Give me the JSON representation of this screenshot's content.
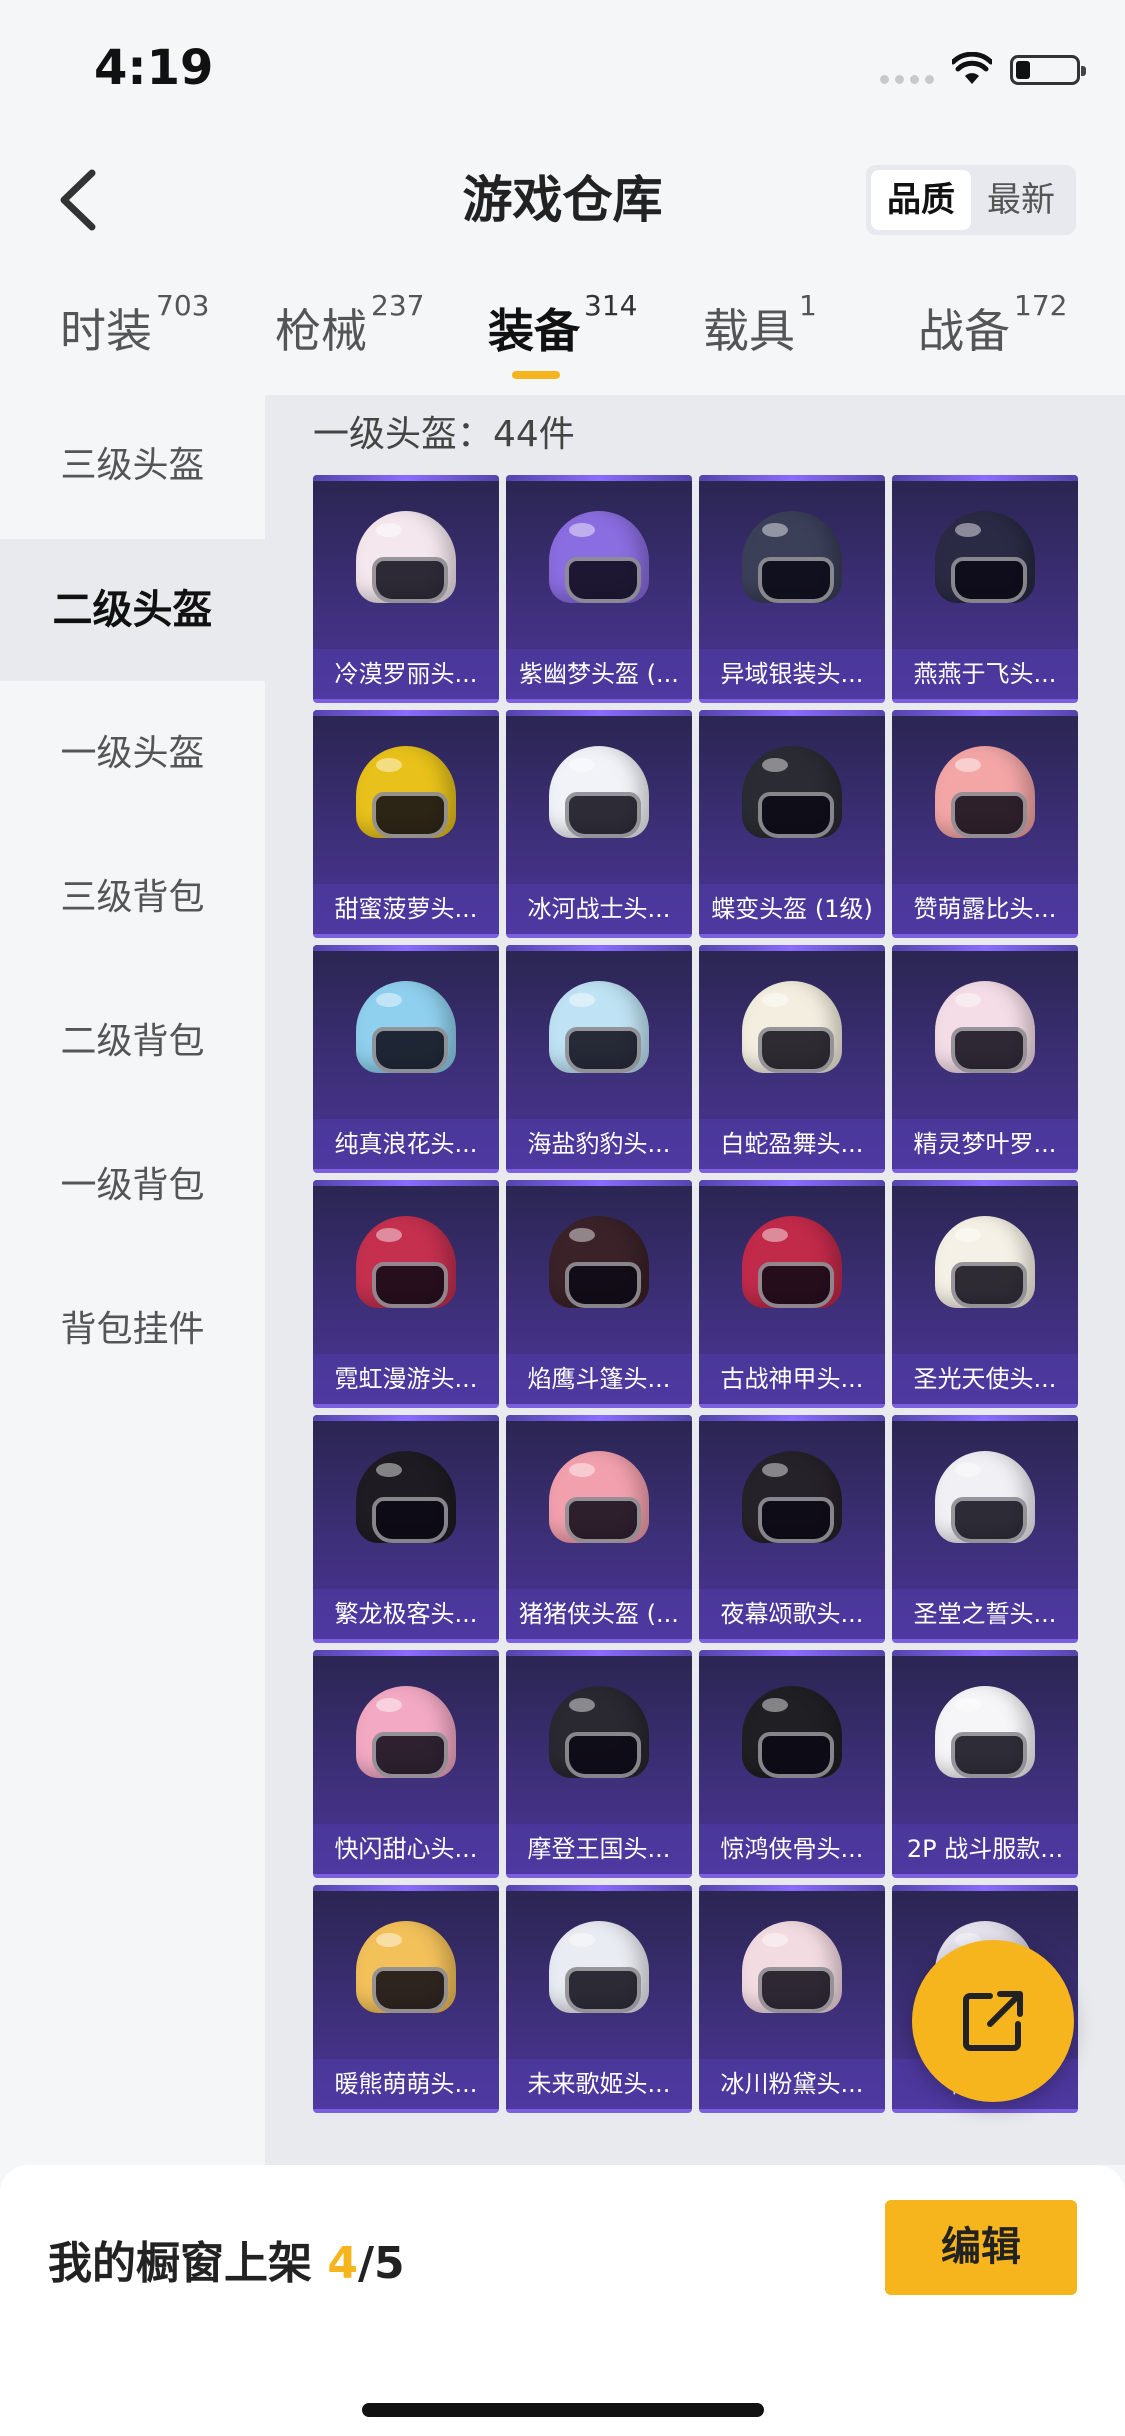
{
  "status_bar": {
    "time": "4:19"
  },
  "header": {
    "title": "游戏仓库",
    "sort_options": [
      "品质",
      "最新"
    ],
    "active_sort": "品质"
  },
  "tabs": [
    {
      "label": "时装",
      "count": "703"
    },
    {
      "label": "枪械",
      "count": "237"
    },
    {
      "label": "装备",
      "count": "314"
    },
    {
      "label": "载具",
      "count": "1"
    },
    {
      "label": "战备",
      "count": "172"
    }
  ],
  "active_tab": "装备",
  "sidebar": {
    "items": [
      "三级头盔",
      "二级头盔",
      "一级头盔",
      "三级背包",
      "二级背包",
      "一级背包",
      "背包挂件"
    ],
    "active": "二级头盔"
  },
  "section_title": "一级头盔：44件",
  "items": [
    {
      "label": "冷漠罗丽头...",
      "color": "#f4e8ee"
    },
    {
      "label": "紫幽梦头盔 (...",
      "color": "#8a6de0"
    },
    {
      "label": "异域银装头...",
      "color": "#3b3f58"
    },
    {
      "label": "燕燕于飞头...",
      "color": "#2a2a44"
    },
    {
      "label": "甜蜜菠萝头...",
      "color": "#e8c21a"
    },
    {
      "label": "冰河战士头...",
      "color": "#f1f3f8"
    },
    {
      "label": "蝶变头盔 (1级)",
      "color": "#2b2b33"
    },
    {
      "label": "赞萌露比头...",
      "color": "#f4a6a6"
    },
    {
      "label": "纯真浪花头...",
      "color": "#8fd0ee"
    },
    {
      "label": "海盐豹豹头...",
      "color": "#bfe3f4"
    },
    {
      "label": "白蛇盈舞头...",
      "color": "#f3eedf"
    },
    {
      "label": "精灵梦叶罗...",
      "color": "#f4dde6"
    },
    {
      "label": "霓虹漫游头...",
      "color": "#c5304f"
    },
    {
      "label": "焰鹰斗篷头...",
      "color": "#3a2228"
    },
    {
      "label": "古战神甲头...",
      "color": "#c22a4a"
    },
    {
      "label": "圣光天使头...",
      "color": "#f6f1e6"
    },
    {
      "label": "繁龙极客头...",
      "color": "#1e1c22"
    },
    {
      "label": "猪猪侠头盔 (...",
      "color": "#f2a0ad"
    },
    {
      "label": "夜幕颂歌头...",
      "color": "#262229"
    },
    {
      "label": "圣堂之誓头...",
      "color": "#f1f0f5"
    },
    {
      "label": "快闪甜心头...",
      "color": "#f3a9c3"
    },
    {
      "label": "摩登王国头...",
      "color": "#2a2830"
    },
    {
      "label": "惊鸿侠骨头...",
      "color": "#202024"
    },
    {
      "label": "2P 战斗服款...",
      "color": "#f6f6f8"
    },
    {
      "label": "暖熊萌萌头...",
      "color": "#f3c15a"
    },
    {
      "label": "未来歌姬头...",
      "color": "#e9ecf2"
    },
    {
      "label": "冰川粉黛头...",
      "color": "#f3dbe2"
    },
    {
      "label": "懵萌...",
      "color": "#e8e4f0"
    }
  ],
  "bottom_bar": {
    "shelf_prefix": "我的橱窗上架",
    "shelf_count": "4",
    "shelf_total": "/5",
    "edit_label": "编辑"
  },
  "colors": {
    "accent": "#f6b51d",
    "card_bg": "#3d2f78"
  }
}
